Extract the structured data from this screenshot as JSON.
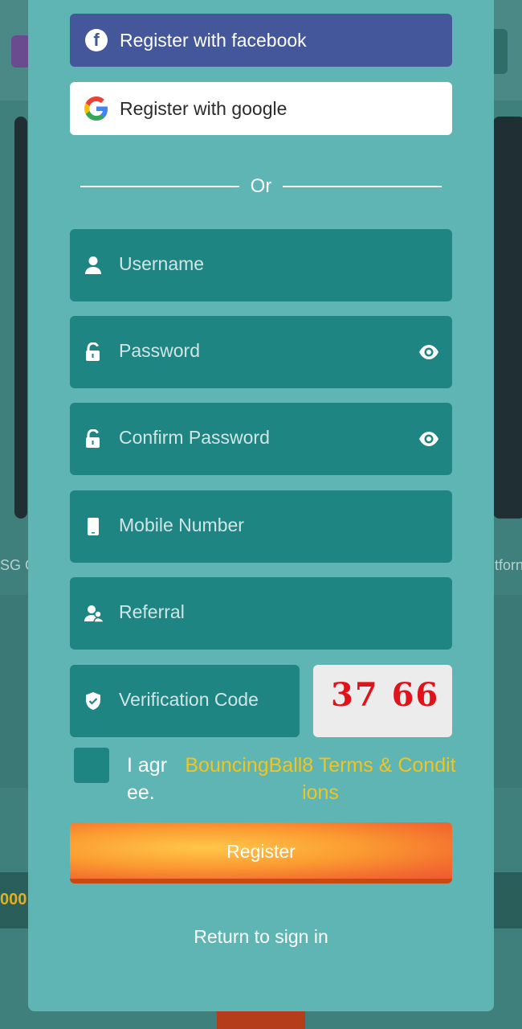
{
  "background": {
    "left_fragment": "SG G",
    "right_fragment": "tforn",
    "bottom_number": "000"
  },
  "social": {
    "facebook_label": "Register with facebook",
    "google_label": "Register with google"
  },
  "divider": {
    "text": "Or"
  },
  "fields": {
    "username": "Username",
    "password": "Password",
    "confirm_password": "Confirm Password",
    "mobile": "Mobile Number",
    "referral": "Referral",
    "verification": "Verification Code"
  },
  "captcha": {
    "code": "37 66"
  },
  "agreement": {
    "prefix": "I agree.",
    "link": "BouncingBall8 Terms & Conditions"
  },
  "register_label": "Register",
  "return_label": "Return to sign in",
  "colors": {
    "modal_bg": "#5fb5b4",
    "field_bg": "#1f8583",
    "facebook": "#44579a",
    "link_yellow": "#f2c41e",
    "register_orange": "#f36c2f"
  }
}
